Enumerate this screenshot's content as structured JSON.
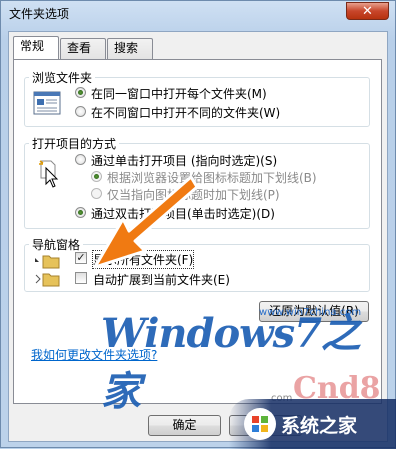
{
  "window": {
    "title": "文件夹选项",
    "close_glyph": "✕"
  },
  "tabs": [
    {
      "label": "常规",
      "active": true
    },
    {
      "label": "查看",
      "active": false
    },
    {
      "label": "搜索",
      "active": false
    }
  ],
  "browse_group": {
    "label": "浏览文件夹",
    "options": [
      {
        "label": "在同一窗口中打开每个文件夹(M)",
        "selected": true
      },
      {
        "label": "在不同窗口中打开不同的文件夹(W)",
        "selected": false
      }
    ]
  },
  "click_group": {
    "label": "打开项目的方式",
    "single_click": {
      "label": "通过单击打开项目 (指向时选定)(S)",
      "selected": false
    },
    "sub_options": [
      {
        "label": "根据浏览器设置给图标标题加下划线(B)",
        "selected": true
      },
      {
        "label": "仅当指向图标标题时加下划线(P)",
        "selected": false
      }
    ],
    "double_click": {
      "label": "通过双击打开项目(单击时选定)(D)",
      "selected": true
    }
  },
  "nav_group": {
    "label": "导航窗格",
    "options": [
      {
        "label": "显示所有文件夹(F)",
        "checked": true
      },
      {
        "label": "自动扩展到当前文件夹(E)",
        "checked": false
      }
    ]
  },
  "restore_button": "还原为默认值(R)",
  "help_link": "我如何更改文件夹选项?",
  "buttons": {
    "ok": "确定"
  },
  "watermarks": {
    "brand": "Windows7之家",
    "url": "www.win7china.com",
    "site": "系统之家",
    "cnd8": "Cnd8",
    "com": "com"
  },
  "colors": {
    "arrow": "#f07a12",
    "brand_blue": "#1d5fb4",
    "radio_green": "#2f7a1c"
  }
}
